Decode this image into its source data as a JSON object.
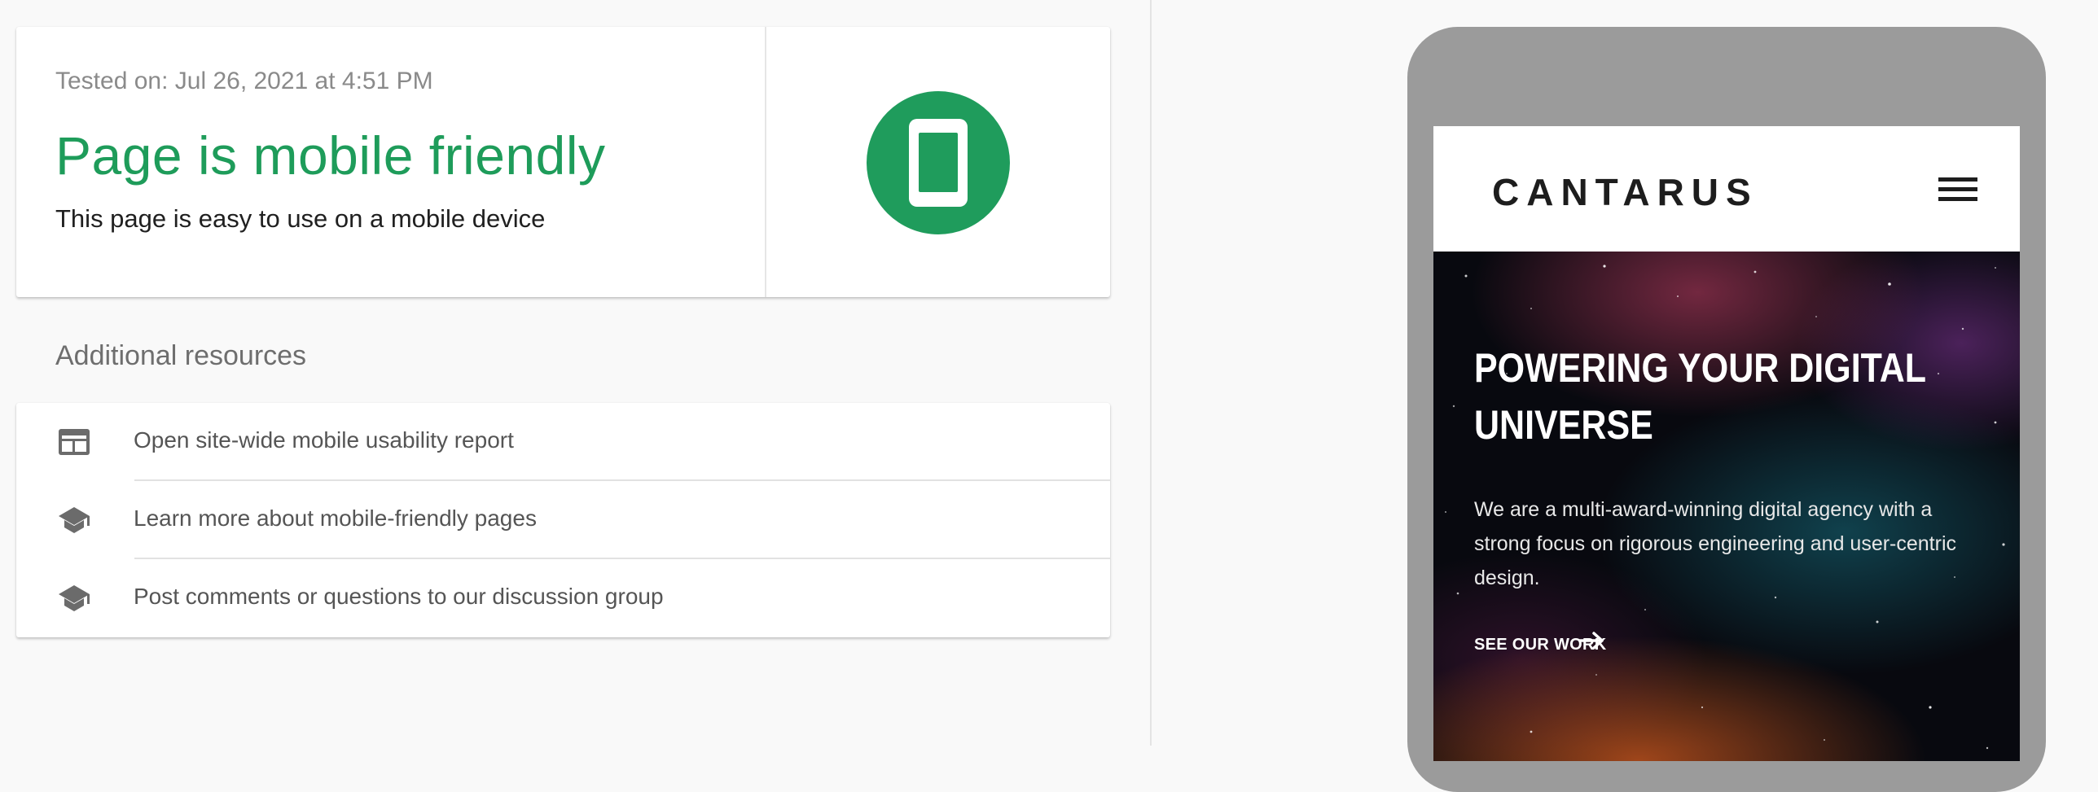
{
  "result": {
    "tested_on": "Tested on: Jul 26, 2021 at 4:51 PM",
    "verdict": "Page is mobile friendly",
    "verdict_subtitle": "This page is easy to use on a mobile device",
    "badge_icon": "smartphone-icon",
    "status_color": "#1e9c5a"
  },
  "resources": {
    "heading": "Additional resources",
    "items": [
      {
        "icon": "report-icon",
        "label": "Open site-wide mobile usability report"
      },
      {
        "icon": "school-icon",
        "label": "Learn more about mobile-friendly pages"
      },
      {
        "icon": "school-icon",
        "label": "Post comments or questions to our discussion group"
      }
    ]
  },
  "preview": {
    "logo": "CANTARUS",
    "menu_icon": "hamburger-menu-icon",
    "hero_title_line1": "POWERING YOUR DIGITAL",
    "hero_title_line2": "UNIVERSE",
    "hero_body": "We are a multi-award-winning digital agency with a strong focus on rigorous engineering and user-centric design.",
    "cta_label": "SEE OUR WORK",
    "cta_icon": "arrow-right-icon"
  }
}
